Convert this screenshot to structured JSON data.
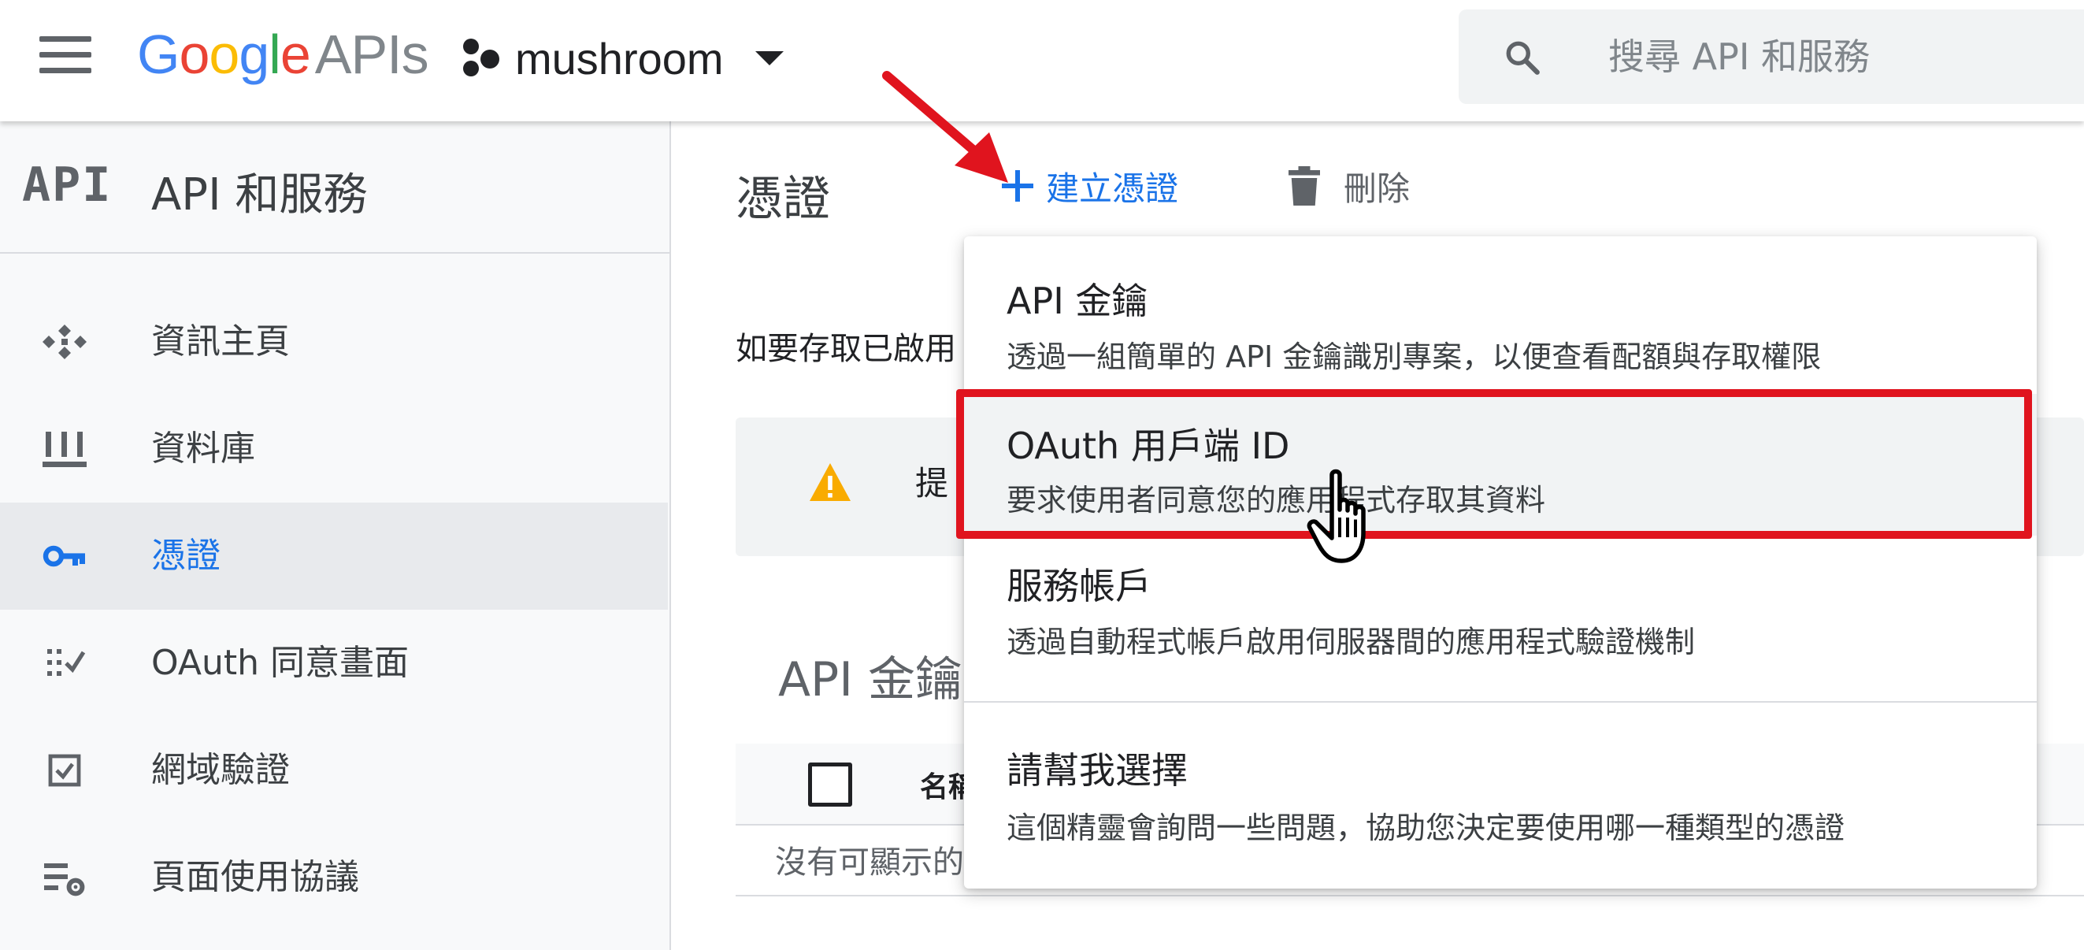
{
  "topbar": {
    "menu_icon": "menu-icon",
    "logo": {
      "google": "Google",
      "apis": "APIs",
      "colors": [
        "#4285F4",
        "#EA4335",
        "#FBBC05",
        "#4285F4",
        "#34A853",
        "#EA4335"
      ]
    },
    "project": {
      "name": "mushroom",
      "icon": "project-dots-icon"
    },
    "search": {
      "placeholder": "搜尋 API 和服務",
      "icon": "search-icon"
    }
  },
  "sidebar": {
    "api_logo": "API",
    "title": "API 和服務",
    "items": [
      {
        "label": "資訊主頁",
        "icon": "dashboard-icon",
        "active": false
      },
      {
        "label": "資料庫",
        "icon": "library-icon",
        "active": false
      },
      {
        "label": "憑證",
        "icon": "key-icon",
        "active": true
      },
      {
        "label": "OAuth 同意畫面",
        "icon": "consent-screen-icon",
        "active": false
      },
      {
        "label": "網域驗證",
        "icon": "domain-check-icon",
        "active": false
      },
      {
        "label": "頁面使用協議",
        "icon": "settings-list-icon",
        "active": false
      }
    ]
  },
  "main": {
    "title": "憑證",
    "toolbar": {
      "create_label": "建立憑證",
      "delete_label": "刪除"
    },
    "intro": "如要存取已啟用",
    "hint": "提",
    "section_title": "API 金鑰",
    "table": {
      "col_name": "名稱",
      "empty": "沒有可顯示的"
    }
  },
  "dropdown": {
    "options": [
      {
        "title": "API 金鑰",
        "desc": "透過一組簡單的 API 金鑰識別專案，以便查看配額與存取權限"
      },
      {
        "title": "OAuth 用戶端 ID",
        "desc": "要求使用者同意您的應用程式存取其資料"
      },
      {
        "title": "服務帳戶",
        "desc": "透過自動程式帳戶啟用伺服器間的應用程式驗證機制"
      },
      {
        "title": "請幫我選擇",
        "desc": "這個精靈會詢問一些問題，協助您決定要使用哪一種類型的憑證"
      }
    ]
  },
  "colors": {
    "accent": "#1a73e8",
    "highlight": "#e0141e",
    "warning": "#f9ab00"
  }
}
